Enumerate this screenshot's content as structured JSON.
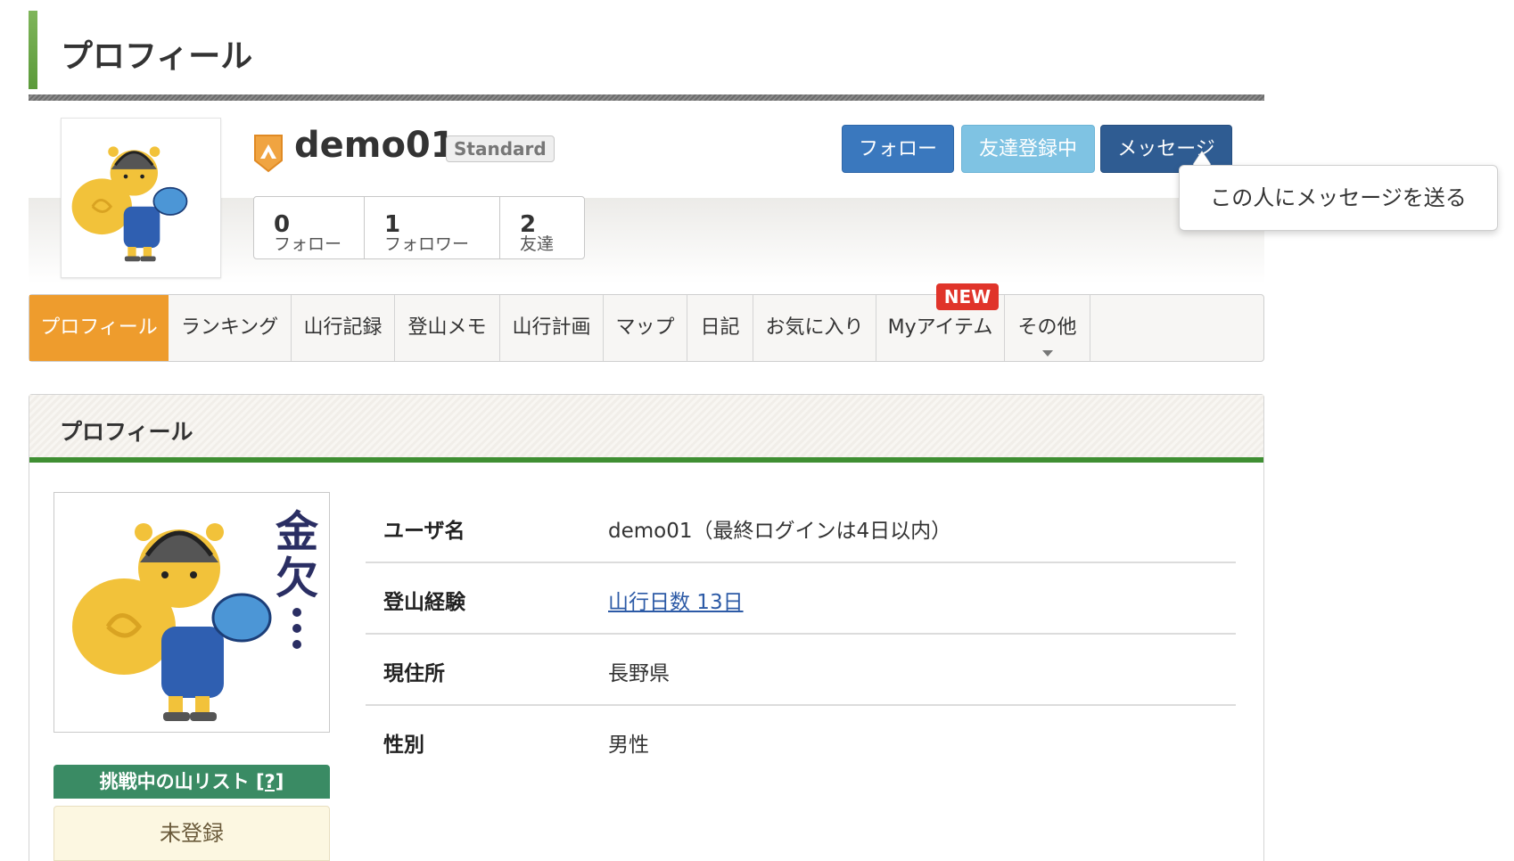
{
  "page_title": "プロフィール",
  "user": {
    "name": "demo01",
    "plan": "Standard"
  },
  "stats": [
    {
      "count": "0",
      "label": "フォロー"
    },
    {
      "count": "1",
      "label": "フォロワー"
    },
    {
      "count": "2",
      "label": "友達"
    }
  ],
  "actions": {
    "follow": "フォロー",
    "friend": "友達登録中",
    "message": "メッセージ",
    "tooltip": "この人にメッセージを送る"
  },
  "tabs": [
    {
      "label": "プロフィール",
      "active": true
    },
    {
      "label": "ランキング"
    },
    {
      "label": "山行記録"
    },
    {
      "label": "登山メモ"
    },
    {
      "label": "山行計画"
    },
    {
      "label": "マップ"
    },
    {
      "label": "日記"
    },
    {
      "label": "お気に入り"
    },
    {
      "label": "Myアイテム"
    },
    {
      "label": "その他"
    }
  ],
  "new_badge": "NEW",
  "section": {
    "title": "プロフィール",
    "rows": [
      {
        "key": "ユーザ名",
        "value": "demo01（最終ログインは4日以内）"
      },
      {
        "key": "登山経験",
        "value": "山行日数 13日"
      },
      {
        "key": "現住所",
        "value": "長野県"
      },
      {
        "key": "性別",
        "value": "男性"
      }
    ],
    "challenge_title": "挑戦中の山リスト",
    "challenge_help": "[?]",
    "challenge_value": "未登録"
  },
  "avatar_text": "金欠…",
  "colors": {
    "active_tab": "#ee9c2d",
    "follow_btn": "#3a78be",
    "friend_btn": "#7fc3e3",
    "message_btn": "#2f5c92",
    "section_rule": "#3f8f33",
    "new_badge": "#e0342a"
  }
}
